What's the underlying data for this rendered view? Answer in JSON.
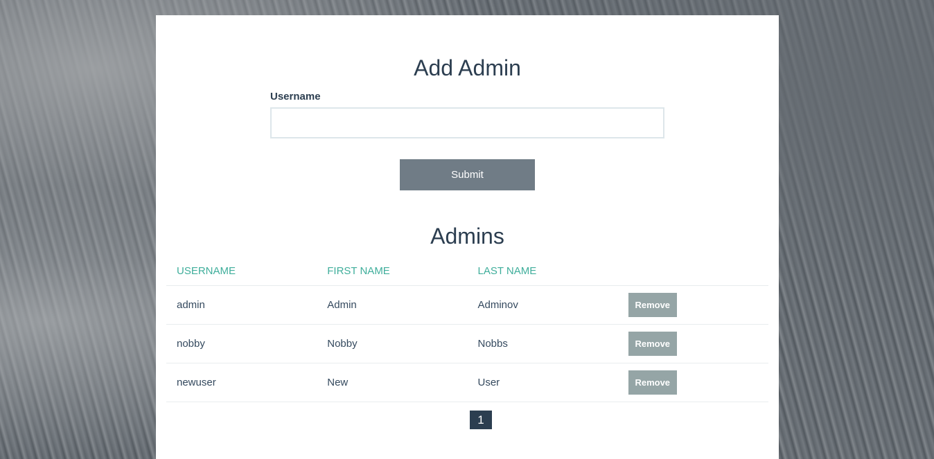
{
  "add_admin": {
    "title": "Add Admin",
    "username_label": "Username",
    "username_value": "",
    "username_placeholder": "",
    "submit_label": "Submit"
  },
  "admins": {
    "title": "Admins",
    "columns": [
      "USERNAME",
      "FIRST NAME",
      "LAST NAME",
      ""
    ],
    "rows": [
      {
        "username": "admin",
        "first_name": "Admin",
        "last_name": "Adminov",
        "action": "Remove"
      },
      {
        "username": "nobby",
        "first_name": "Nobby",
        "last_name": "Nobbs",
        "action": "Remove"
      },
      {
        "username": "newuser",
        "first_name": "New",
        "last_name": "User",
        "action": "Remove"
      }
    ]
  },
  "pagination": {
    "current_page": "1"
  },
  "colors": {
    "heading": "#2c3e50",
    "column_header": "#3fae9b",
    "submit_button": "#707c86",
    "remove_button": "#95a5a6",
    "page_active": "#2c3e50"
  }
}
